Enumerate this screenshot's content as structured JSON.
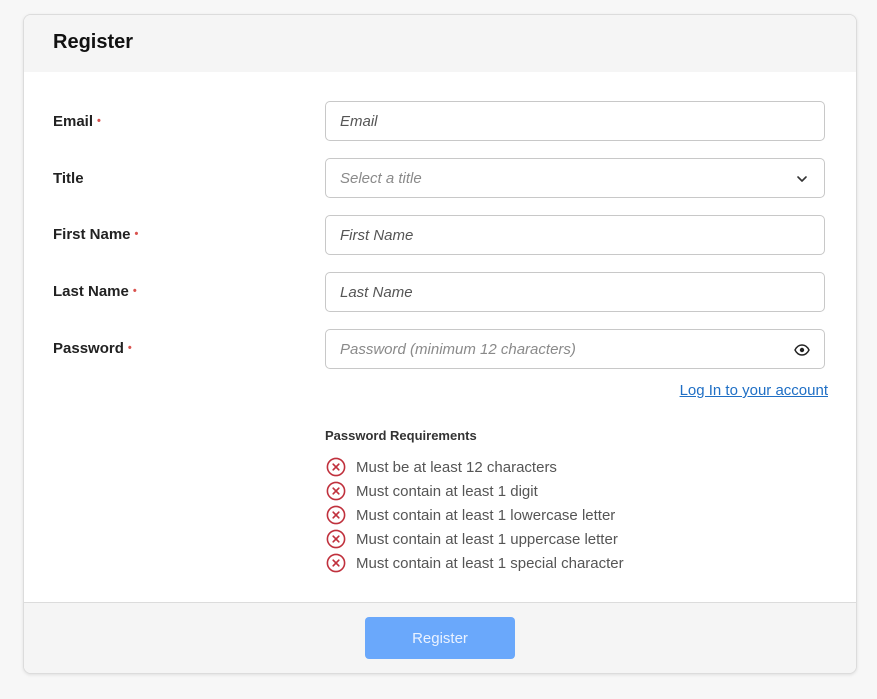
{
  "form": {
    "title": "Register",
    "required_marker": "•",
    "fields": {
      "email": {
        "label": "Email",
        "placeholder": "Email",
        "required": true
      },
      "title": {
        "label": "Title",
        "placeholder": "Select a title",
        "required": false
      },
      "first_name": {
        "label": "First Name",
        "placeholder": "First Name",
        "required": true
      },
      "last_name": {
        "label": "Last Name",
        "placeholder": "Last Name",
        "required": true
      },
      "password": {
        "label": "Password",
        "placeholder": "Password (minimum 12 characters)",
        "required": true
      }
    },
    "login_link": "Log In to your account",
    "password_requirements": {
      "title": "Password Requirements",
      "items": [
        "Must be at least 12 characters",
        "Must contain at least 1 digit",
        "Must contain at least 1 lowercase letter",
        "Must contain at least 1 uppercase letter",
        "Must contain at least 1 special character"
      ],
      "status_icon": "x-circle-icon"
    },
    "submit_label": "Register"
  },
  "colors": {
    "accent": "#6aa8fb",
    "link": "#1f6fc5",
    "error": "#c0313d",
    "required": "#d9534f"
  }
}
